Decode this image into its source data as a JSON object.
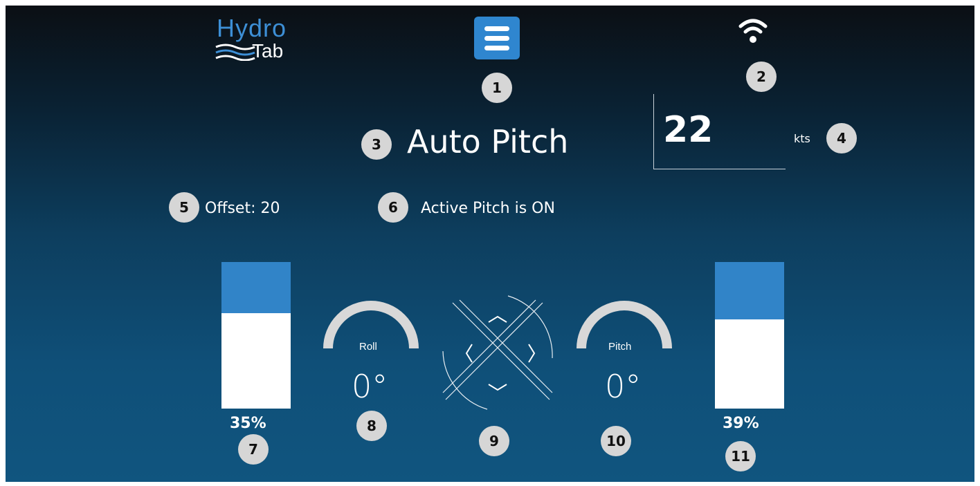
{
  "app": {
    "logo_hydro": "Hydro",
    "logo_tab": "Tab"
  },
  "header": {
    "menu_icon": "hamburger-menu-icon",
    "wifi_icon": "wifi-icon"
  },
  "mode": {
    "title": "Auto Pitch"
  },
  "speed": {
    "value": "22",
    "unit": "kts"
  },
  "status": {
    "offset": "Offset: 20",
    "active_pitch": "Active Pitch is ON"
  },
  "tabs": {
    "left": {
      "percent_label": "35%",
      "value": 35
    },
    "right": {
      "percent_label": "39%",
      "value": 39
    }
  },
  "gauges": {
    "roll": {
      "label": "Roll",
      "value": "0°"
    },
    "pitch": {
      "label": "Pitch",
      "value": "0°"
    }
  },
  "joystick": {
    "icon": "directional-joystick-icon"
  },
  "callouts": [
    "1",
    "2",
    "3",
    "4",
    "5",
    "6",
    "7",
    "8",
    "9",
    "10",
    "11"
  ],
  "colors": {
    "accent": "#2f86cf",
    "bar_fill": "#3184c8",
    "badge": "#d6d6d6"
  }
}
